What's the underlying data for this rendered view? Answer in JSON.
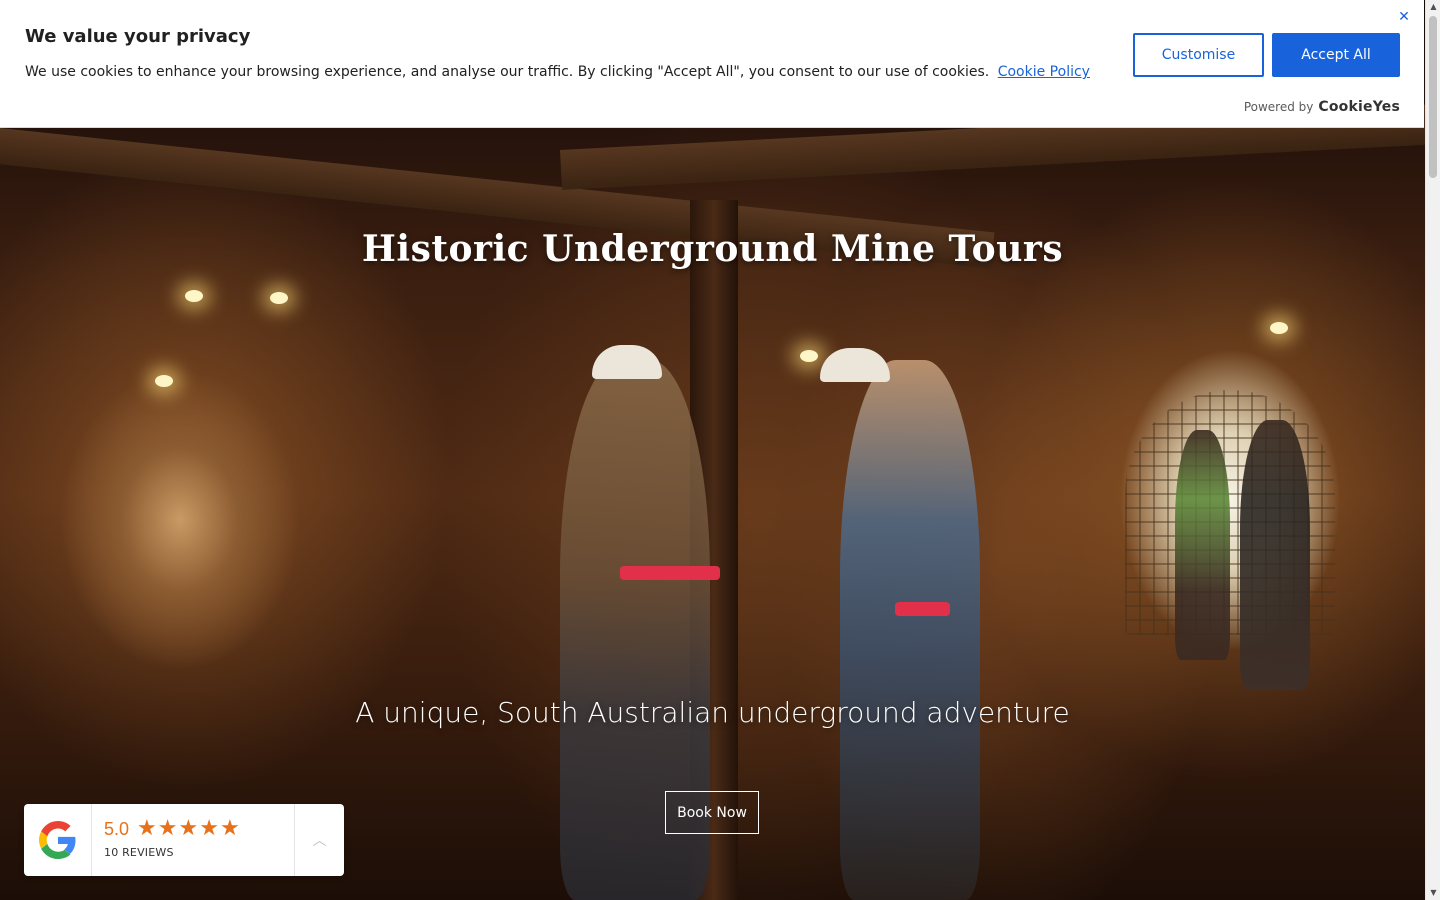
{
  "cookie_banner": {
    "title": "We value your privacy",
    "text": "We use cookies to enhance your browsing experience, and analyse our traffic. By clicking \"Accept All\", you consent to our use of cookies.",
    "policy_link": "Cookie Policy",
    "customise_label": "Customise",
    "accept_label": "Accept All",
    "close_icon": "close-icon",
    "powered_by": "Powered by",
    "brand": "CookieYes",
    "accent_color": "#1863dc"
  },
  "hero": {
    "title": "Historic Underground Mine Tours",
    "subtitle": "A unique, South Australian underground adventure",
    "cta_label": "Book Now"
  },
  "reviews_widget": {
    "logo_icon": "google-g-icon",
    "score": "5.0",
    "stars": 5,
    "count_label": "10 REVIEWS",
    "toggle_icon": "chevron-up-icon",
    "star_color": "#e7711b"
  }
}
